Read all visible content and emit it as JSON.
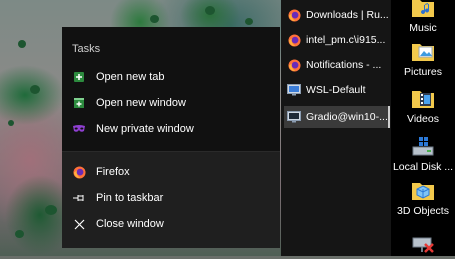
{
  "jumplist": {
    "header": "Tasks",
    "tasks": [
      {
        "label": "Open new tab",
        "icon": "new-tab-icon"
      },
      {
        "label": "Open new window",
        "icon": "new-window-icon"
      },
      {
        "label": "New private window",
        "icon": "private-mask-icon"
      }
    ],
    "actions": [
      {
        "label": "Firefox",
        "icon": "firefox-icon"
      },
      {
        "label": "Pin to taskbar",
        "icon": "pin-icon"
      },
      {
        "label": "Close window",
        "icon": "close-icon"
      }
    ]
  },
  "taskbar_list": {
    "items": [
      {
        "label": "Downloads | Ru...",
        "icon": "firefox-icon"
      },
      {
        "label": "intel_pm.c\\i915...",
        "icon": "firefox-icon"
      },
      {
        "label": "Notifications - ...",
        "icon": "firefox-icon"
      },
      {
        "label": "WSL-Default",
        "icon": "remote-desktop-icon"
      },
      {
        "label": "Gradio@win10-...",
        "icon": "remote-desktop-icon",
        "active": true
      }
    ]
  },
  "desktop": {
    "icons": [
      {
        "label": "Music",
        "icon": "music-folder-icon"
      },
      {
        "label": "Pictures",
        "icon": "pictures-folder-icon"
      },
      {
        "label": "Videos",
        "icon": "videos-folder-icon"
      },
      {
        "label": "Local Disk ...",
        "icon": "local-disk-icon"
      },
      {
        "label": "3D Objects",
        "icon": "3d-objects-folder-icon"
      },
      {
        "label": "",
        "icon": "network-drive-icon"
      }
    ]
  },
  "colors": {
    "menu_bg": "#111111",
    "menu_lower_bg": "#1f1f1f",
    "firefox_orange": "#ff7139",
    "private_purple": "#8f3fd1",
    "folder_yellow": "#f2c94c"
  }
}
